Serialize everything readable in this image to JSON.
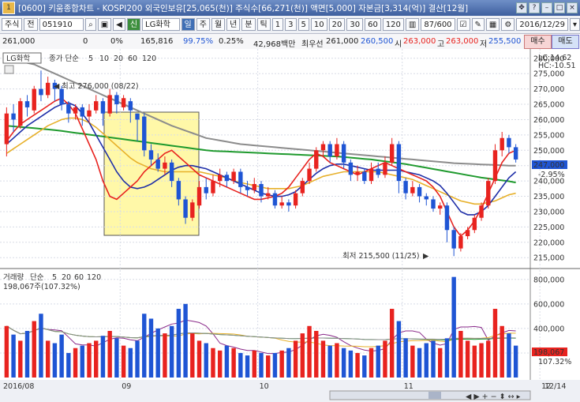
{
  "window": {
    "title": "[0600] 키움종합차트 - KOSPI200 외국인보유[25,065(천)] 주식수[66,271(천)] 액면[5,000] 자본금[3,314(억)] 결산[12월]",
    "app_icon": "1"
  },
  "toolbar": {
    "type_select": "주식",
    "prefix": "전",
    "code": "051910",
    "name_badge": "신",
    "name": "LG화학",
    "periods": [
      "일",
      "주",
      "월",
      "년",
      "분",
      "틱"
    ],
    "active_period": "일",
    "intervals": [
      "1",
      "3",
      "5",
      "10",
      "20",
      "30",
      "60",
      "120"
    ],
    "page_counter": "87/600",
    "date": "2016/12/29"
  },
  "quote": {
    "price": "261,000",
    "change": "0",
    "change_rate": "0%",
    "volume": "165,816",
    "ratio": "99.75%",
    "turnover": "0.25%",
    "amount": "42,968백만",
    "best_label": "최우선",
    "best_price": "261,000",
    "bid": "260,500",
    "open_label": "시",
    "open": "263,000",
    "high_label": "고",
    "high": "263,000",
    "low_label": "저",
    "low": "255,500",
    "buy_label": "매수",
    "sell_label": "매도"
  },
  "price_panel": {
    "legend_name": "LG화학",
    "legend_ma": "종가 단순",
    "ma_periods": [
      "5",
      "10",
      "20",
      "60",
      "120"
    ],
    "lc": "LC:14.62",
    "hc": "HC:-10.51",
    "current_tag": "247,000",
    "pct_tag": "-2.95%",
    "high_annot": "최고 276,000 (08/22)",
    "low_annot": "최저 215,500 (11/25)"
  },
  "volume_panel": {
    "legend_name": "거래량",
    "legend_ma": "단순",
    "ma_periods": [
      "5",
      "20",
      "60",
      "120"
    ],
    "readout": "198,067주(107.32%)",
    "current_tag": "198,067",
    "pct_tag": "107.32%"
  },
  "colors": {
    "up": "#e8231f",
    "down": "#1f55d4",
    "ma5": "#e8231f",
    "ma10": "#1f2fa8",
    "ma20": "#e7b02a",
    "ma60": "#1f9a2e",
    "ma120": "#8c8c8c",
    "highlight": "#fff8a8"
  },
  "chart_data": {
    "type": "candlestick",
    "x_axis_labels": [
      "2016/08",
      "09",
      "10",
      "11",
      "12",
      "12/14"
    ],
    "y_ticks": [
      215000,
      220000,
      225000,
      230000,
      235000,
      240000,
      245000,
      250000,
      255000,
      260000,
      265000,
      270000,
      275000,
      280000
    ],
    "y_tick_labels": [
      "215,000",
      "220,000",
      "225,000",
      "230,000",
      "235,000",
      "240,000",
      "245,000",
      "250,000",
      "255,000",
      "260,000",
      "265,000",
      "270,000",
      "275,000",
      "280,000"
    ],
    "ylim": [
      213000,
      282000
    ],
    "volume_ticks": [
      200000,
      400000,
      600000,
      800000
    ],
    "volume_tick_labels": [
      "200,000",
      "400,000",
      "600,000",
      "800,000"
    ],
    "volume_ylim": [
      0,
      850000
    ],
    "series": [
      {
        "name": "5",
        "values": [
          253000,
          256000,
          258500,
          260000,
          261500,
          263000,
          264500,
          266000,
          267000,
          265000,
          262000,
          257000,
          252000,
          247000,
          240000,
          235000,
          234000,
          236000,
          238000,
          240000,
          243000,
          245000,
          247000,
          249000,
          250000,
          248000,
          246000,
          244000,
          242000,
          241000,
          240000,
          239000,
          238000,
          237000,
          236000,
          235000,
          234000,
          234000,
          234500,
          235000,
          236000,
          238000,
          241000,
          244000,
          247000,
          249000,
          248000,
          246000,
          245000,
          244000,
          243000,
          242000,
          243000,
          244000,
          245000,
          246000,
          245000,
          244000,
          243000,
          242000,
          241000,
          240000,
          238000,
          235000,
          230000,
          225000,
          222000,
          224000,
          227000,
          231000,
          236000,
          241000,
          246000,
          249000,
          250000
        ]
      },
      {
        "name": "10",
        "values": [
          252000,
          254000,
          256000,
          258000,
          259500,
          261000,
          262500,
          264000,
          265000,
          265500,
          264500,
          262000,
          259000,
          255000,
          251000,
          247000,
          243000,
          240000,
          238000,
          237500,
          238000,
          239000,
          240500,
          242000,
          243500,
          244500,
          245000,
          245000,
          244500,
          244000,
          243000,
          242000,
          241000,
          240000,
          239000,
          238000,
          237000,
          236000,
          235500,
          235000,
          235000,
          235500,
          236500,
          238500,
          240500,
          242500,
          244000,
          245000,
          245500,
          245500,
          245000,
          244500,
          244000,
          243500,
          243500,
          243500,
          243500,
          243500,
          243000,
          242500,
          242000,
          241000,
          240000,
          238500,
          236000,
          233000,
          230000,
          229000,
          229000,
          230000,
          232000,
          235000,
          238000,
          241000,
          243000
        ]
      },
      {
        "name": "20",
        "values": [
          249000,
          250500,
          252000,
          253500,
          255000,
          256500,
          258000,
          259000,
          260000,
          260500,
          260500,
          260000,
          259000,
          257500,
          255500,
          253500,
          251500,
          249500,
          247500,
          246000,
          245000,
          244000,
          243500,
          243000,
          243000,
          243000,
          243000,
          243000,
          243000,
          242500,
          242000,
          241500,
          241000,
          240000,
          239500,
          239000,
          238500,
          238000,
          237500,
          237500,
          237500,
          237500,
          238000,
          238500,
          239500,
          240500,
          241500,
          242000,
          242500,
          243000,
          243000,
          243000,
          243000,
          243000,
          243000,
          242500,
          242000,
          241500,
          241000,
          240500,
          239500,
          238500,
          237500,
          236500,
          235500,
          234500,
          233500,
          233000,
          232500,
          232500,
          233000,
          233500,
          234500,
          235500,
          236000
        ]
      },
      {
        "name": "60",
        "values": [
          258000,
          257800,
          257600,
          257400,
          257200,
          257000,
          256800,
          256600,
          256300,
          256000,
          255700,
          255400,
          255100,
          254800,
          254500,
          254200,
          253900,
          253600,
          253300,
          253000,
          252700,
          252400,
          252100,
          251800,
          251500,
          251200,
          250900,
          250600,
          250300,
          250000,
          249800,
          249700,
          249600,
          249500,
          249400,
          249300,
          249200,
          249100,
          249000,
          248900,
          248800,
          248700,
          248600,
          248500,
          248400,
          248300,
          248200,
          248100,
          248000,
          247800,
          247600,
          247400,
          247200,
          247000,
          246700,
          246400,
          246100,
          245800,
          245500,
          245100,
          244700,
          244300,
          243900,
          243500,
          243100,
          242700,
          242300,
          241900,
          241500,
          241100,
          240800,
          240500,
          240200,
          239900,
          239500
        ]
      },
      {
        "name": "120",
        "values": [
          280000,
          279500,
          279000,
          278500,
          278000,
          277000,
          276000,
          275000,
          274000,
          273000,
          272000,
          271000,
          270000,
          269000,
          268000,
          267000,
          266000,
          265000,
          264000,
          263000,
          262000,
          261000,
          260000,
          259000,
          258000,
          257200,
          256400,
          255600,
          254800,
          254000,
          253600,
          253200,
          252800,
          252400,
          252000,
          251800,
          251600,
          251400,
          251200,
          251000,
          250800,
          250600,
          250400,
          250200,
          250000,
          249800,
          249600,
          249400,
          249200,
          249000,
          248800,
          248600,
          248400,
          248200,
          248000,
          247800,
          247600,
          247400,
          247200,
          247000,
          246800,
          246600,
          246400,
          246200,
          246000,
          245800,
          245700,
          245600,
          245500,
          245400,
          245300,
          245200,
          245100,
          245000,
          245000
        ]
      }
    ],
    "candles": [
      [
        252000,
        262000,
        248000,
        264000
      ],
      [
        262000,
        260000,
        256000,
        265000
      ],
      [
        258000,
        266000,
        257000,
        267000
      ],
      [
        266000,
        264000,
        261000,
        268000
      ],
      [
        263000,
        270000,
        262000,
        271000
      ],
      [
        270000,
        268000,
        266000,
        276000
      ],
      [
        268000,
        272000,
        267000,
        274000
      ],
      [
        272000,
        270000,
        266000,
        273000
      ],
      [
        270000,
        265000,
        263000,
        271000
      ],
      [
        265000,
        262000,
        259000,
        266000
      ],
      [
        262000,
        264000,
        260000,
        265000
      ],
      [
        264000,
        261000,
        258000,
        265000
      ],
      [
        261000,
        263000,
        259000,
        265000
      ],
      [
        263000,
        266000,
        262000,
        268000
      ],
      [
        266000,
        262000,
        258000,
        267000
      ],
      [
        262000,
        268000,
        261000,
        270000
      ],
      [
        268000,
        265000,
        262000,
        269000
      ],
      [
        264000,
        267000,
        263000,
        268000
      ],
      [
        266000,
        263000,
        259000,
        267000
      ],
      [
        262000,
        260000,
        253000,
        262000
      ],
      [
        261000,
        250000,
        248000,
        262000
      ],
      [
        250000,
        247000,
        245000,
        252000
      ],
      [
        247000,
        244000,
        243000,
        249000
      ],
      [
        244000,
        246000,
        242000,
        248000
      ],
      [
        246000,
        240000,
        238000,
        247000
      ],
      [
        240000,
        234000,
        232000,
        241000
      ],
      [
        234000,
        228000,
        226000,
        235000
      ],
      [
        228000,
        233000,
        227000,
        234000
      ],
      [
        232000,
        238000,
        231000,
        240000
      ],
      [
        238000,
        236000,
        234000,
        241000
      ],
      [
        236000,
        240000,
        235000,
        242000
      ],
      [
        240000,
        242000,
        238000,
        244000
      ],
      [
        242000,
        240000,
        238000,
        243000
      ],
      [
        240000,
        243000,
        239000,
        244000
      ],
      [
        243000,
        238000,
        236000,
        244000
      ],
      [
        238000,
        237000,
        235000,
        240000
      ],
      [
        237000,
        239000,
        236000,
        241000
      ],
      [
        239000,
        235000,
        233000,
        240000
      ],
      [
        235000,
        236000,
        234000,
        238000
      ],
      [
        236000,
        232000,
        231000,
        237000
      ],
      [
        232000,
        233000,
        231000,
        235000
      ],
      [
        233000,
        232000,
        230000,
        234000
      ],
      [
        232000,
        236000,
        231000,
        237000
      ],
      [
        236000,
        240000,
        235000,
        241000
      ],
      [
        240000,
        244000,
        239000,
        246000
      ],
      [
        244000,
        250000,
        243000,
        251000
      ],
      [
        250000,
        252000,
        248000,
        253000
      ],
      [
        252000,
        248000,
        246000,
        253000
      ],
      [
        248000,
        252000,
        247000,
        254000
      ],
      [
        252000,
        246000,
        244000,
        253000
      ],
      [
        246000,
        242000,
        240000,
        247000
      ],
      [
        242000,
        243000,
        240000,
        245000
      ],
      [
        243000,
        240000,
        239000,
        244000
      ],
      [
        240000,
        244000,
        239000,
        246000
      ],
      [
        244000,
        242000,
        241000,
        246000
      ],
      [
        242000,
        246000,
        241000,
        248000
      ],
      [
        246000,
        252000,
        245000,
        254000
      ],
      [
        252000,
        240000,
        236000,
        253000
      ],
      [
        240000,
        236000,
        234000,
        241000
      ],
      [
        236000,
        238000,
        235000,
        240000
      ],
      [
        238000,
        235000,
        233000,
        239000
      ],
      [
        235000,
        234000,
        232000,
        236000
      ],
      [
        234000,
        231000,
        230000,
        235000
      ],
      [
        231000,
        232000,
        229000,
        233000
      ],
      [
        232000,
        224000,
        220000,
        233000
      ],
      [
        224000,
        218000,
        215500,
        225000
      ],
      [
        218000,
        222000,
        217000,
        223000
      ],
      [
        222000,
        224000,
        221000,
        225000
      ],
      [
        224000,
        228000,
        223000,
        229000
      ],
      [
        228000,
        232000,
        227000,
        233000
      ],
      [
        232000,
        240000,
        231000,
        241000
      ],
      [
        240000,
        250000,
        239000,
        252000
      ],
      [
        250000,
        254000,
        248000,
        256000
      ],
      [
        254000,
        251000,
        249000,
        255000
      ],
      [
        251000,
        247000,
        246000,
        252000
      ]
    ],
    "volumes": [
      420000,
      350000,
      300000,
      380000,
      460000,
      520000,
      300000,
      280000,
      350000,
      200000,
      240000,
      260000,
      280000,
      300000,
      340000,
      380000,
      320000,
      260000,
      240000,
      300000,
      520000,
      480000,
      400000,
      360000,
      420000,
      560000,
      600000,
      360000,
      300000,
      280000,
      240000,
      220000,
      260000,
      240000,
      200000,
      180000,
      220000,
      200000,
      180000,
      200000,
      220000,
      240000,
      300000,
      360000,
      420000,
      380000,
      300000,
      260000,
      280000,
      240000,
      220000,
      200000,
      180000,
      240000,
      260000,
      300000,
      560000,
      460000,
      320000,
      260000,
      240000,
      280000,
      300000,
      240000,
      320000,
      820000,
      380000,
      300000,
      260000,
      280000,
      300000,
      560000,
      420000,
      360000,
      260000
    ]
  }
}
